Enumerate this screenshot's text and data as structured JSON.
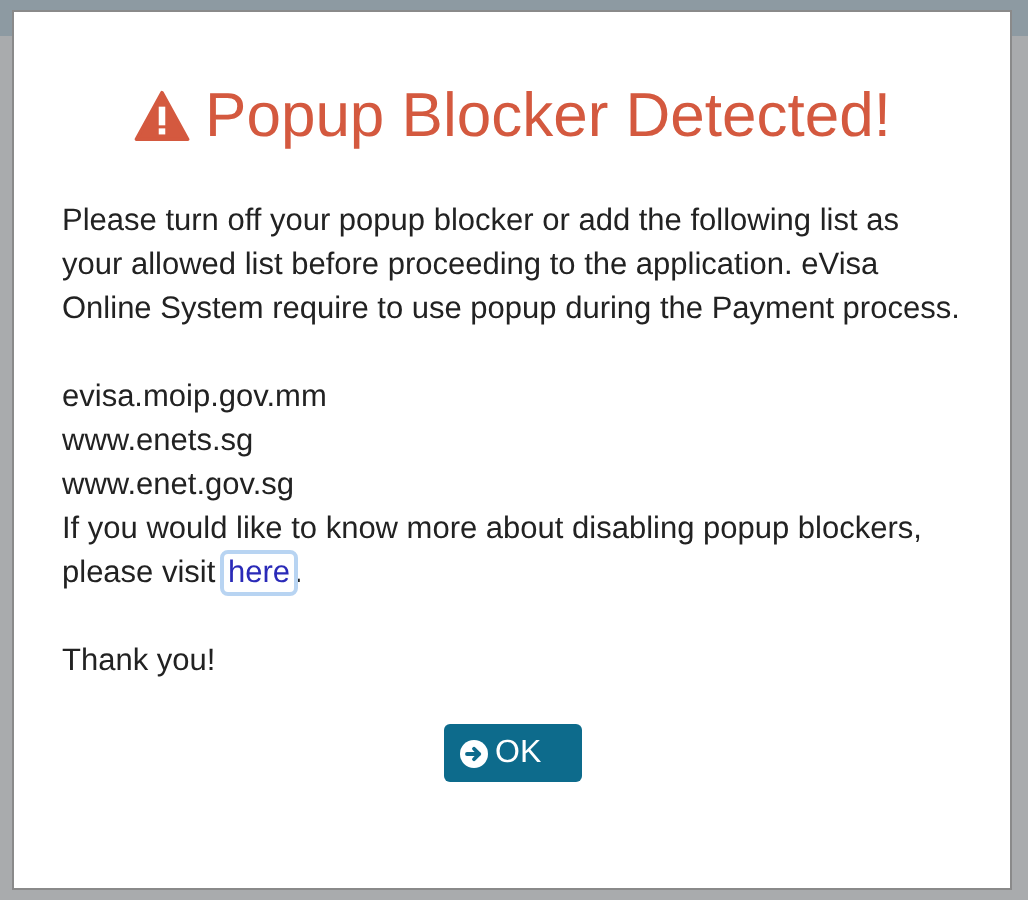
{
  "dialog": {
    "title": "Popup Blocker Detected!",
    "message": "Please turn off your popup blocker or add the following list as your allowed list before proceeding to the application. eVisa Online System require to use popup during the Payment process.",
    "sites": [
      "evisa.moip.gov.mm",
      "www.enets.sg",
      "www.enet.gov.sg"
    ],
    "more_info": {
      "text": "If you would like to know more about disabling popup blockers, please visit ",
      "link": {
        "label": "here",
        "focused": true
      },
      "suffix": "."
    },
    "closing": "Thank you!",
    "button": {
      "label": "OK"
    }
  }
}
